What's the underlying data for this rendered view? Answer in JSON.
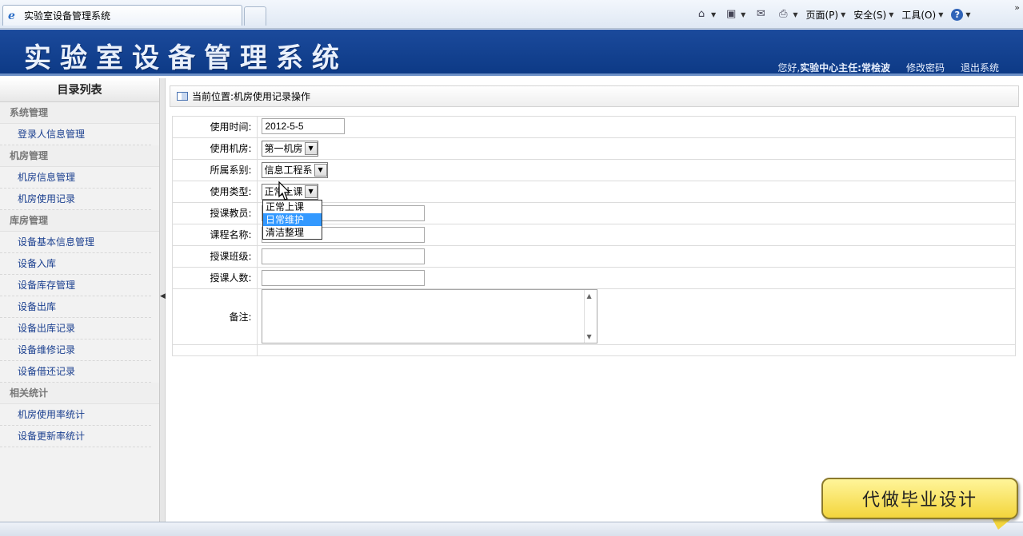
{
  "browser": {
    "tab_title": "实验室设备管理系统",
    "toolbar": {
      "page": "页面(P)",
      "safety": "安全(S)",
      "tools": "工具(O)",
      "help": "?"
    }
  },
  "header": {
    "system_title": "实验室设备管理系统",
    "greeting": "您好,",
    "role_user": "实验中心主任:常桧波",
    "change_password": "修改密码",
    "logout": "退出系统"
  },
  "sidebar": {
    "title": "目录列表",
    "groups": [
      {
        "label": "系统管理",
        "items": [
          "登录人信息管理"
        ]
      },
      {
        "label": "机房管理",
        "items": [
          "机房信息管理",
          "机房使用记录"
        ]
      },
      {
        "label": "库房管理",
        "items": [
          "设备基本信息管理",
          "设备入库",
          "设备库存管理",
          "设备出库",
          "设备出库记录",
          "设备维修记录",
          "设备借还记录"
        ]
      },
      {
        "label": "相关统计",
        "items": [
          "机房使用率统计",
          "设备更新率统计"
        ]
      }
    ]
  },
  "breadcrumb": {
    "label": "当前位置:",
    "path": "机房使用记录操作"
  },
  "form": {
    "use_time": {
      "label": "使用时间:",
      "value": "2012-5-5"
    },
    "room": {
      "label": "使用机房:",
      "value": "第一机房"
    },
    "department": {
      "label": "所属系别:",
      "value": "信息工程系"
    },
    "use_type": {
      "label": "使用类型:",
      "value": "正常上课",
      "options": [
        "正常上课",
        "日常维护",
        "清洁整理"
      ],
      "highlighted": "日常维护"
    },
    "teacher": {
      "label": "授课教员:",
      "value": ""
    },
    "course": {
      "label": "课程名称:",
      "value": ""
    },
    "class": {
      "label": "授课班级:",
      "value": ""
    },
    "count": {
      "label": "授课人数:",
      "value": ""
    },
    "remark": {
      "label": "备注:",
      "value": ""
    }
  },
  "promo": {
    "text": "代做毕业设计"
  },
  "colors": {
    "banner": "#0d3a86",
    "link": "#1a3f8f",
    "highlight": "#3399ff",
    "promo": "#f3d53c"
  }
}
